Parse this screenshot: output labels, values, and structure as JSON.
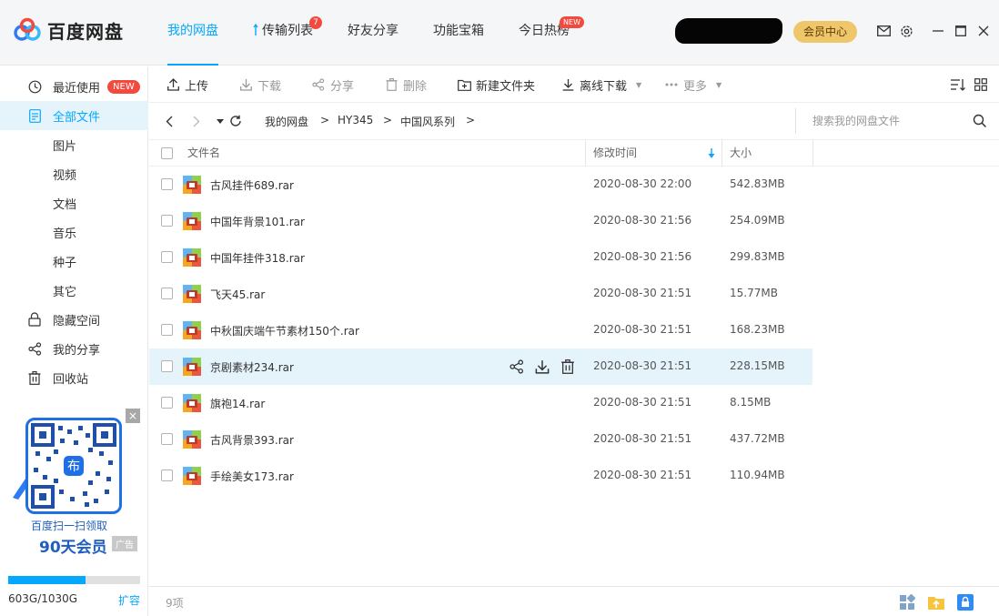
{
  "app": {
    "name": "百度网盘"
  },
  "nav": [
    {
      "label": "我的网盘",
      "active": true
    },
    {
      "label": "传输列表",
      "badge": "7"
    },
    {
      "label": "好友分享"
    },
    {
      "label": "功能宝箱"
    },
    {
      "label": "今日热榜",
      "badge": "NEW"
    }
  ],
  "header": {
    "vip_label": "会员中心"
  },
  "sidebar": {
    "items": [
      {
        "label": "最近使用",
        "badge": "NEW",
        "icon": "clock-icon"
      },
      {
        "label": "全部文件",
        "icon": "document-icon",
        "active": true
      },
      {
        "label": "图片"
      },
      {
        "label": "视频"
      },
      {
        "label": "文档"
      },
      {
        "label": "音乐"
      },
      {
        "label": "种子"
      },
      {
        "label": "其它"
      },
      {
        "label": "隐藏空间",
        "icon": "lock-icon"
      },
      {
        "label": "我的分享",
        "icon": "share-icon"
      },
      {
        "label": "回收站",
        "icon": "trash-icon"
      }
    ],
    "promo": {
      "line1": "百度扫一扫领取",
      "line2": "90天会员",
      "ad_label": "广告",
      "close": "×"
    },
    "storage": {
      "used_text": "603G/1030G",
      "fraction": 0.585,
      "expand_label": "扩容"
    }
  },
  "toolbar": {
    "upload": "上传",
    "download": "下载",
    "share": "分享",
    "delete": "删除",
    "new_folder": "新建文件夹",
    "offline_download": "离线下载",
    "more": "更多"
  },
  "path": {
    "crumbs": [
      "我的网盘",
      "HY345",
      "中国风系列"
    ],
    "separator": ">",
    "search_placeholder": "搜索我的网盘文件"
  },
  "table": {
    "headers": {
      "name": "文件名",
      "modified": "修改时间",
      "size": "大小"
    },
    "rows": [
      {
        "name": "古风挂件689.rar",
        "modified": "2020-08-30 22:00",
        "size": "542.83MB"
      },
      {
        "name": "中国年背景101.rar",
        "modified": "2020-08-30 21:56",
        "size": "254.09MB"
      },
      {
        "name": "中国年挂件318.rar",
        "modified": "2020-08-30 21:56",
        "size": "299.83MB"
      },
      {
        "name": "飞天45.rar",
        "modified": "2020-08-30 21:51",
        "size": "15.77MB"
      },
      {
        "name": "中秋国庆端午节素材150个.rar",
        "modified": "2020-08-30 21:51",
        "size": "168.23MB"
      },
      {
        "name": "京剧素材234.rar",
        "modified": "2020-08-30 21:51",
        "size": "228.15MB",
        "hovered": true
      },
      {
        "name": "旗袍14.rar",
        "modified": "2020-08-30 21:51",
        "size": "8.15MB"
      },
      {
        "name": "古风背景393.rar",
        "modified": "2020-08-30 21:51",
        "size": "437.72MB"
      },
      {
        "name": "手绘美女173.rar",
        "modified": "2020-08-30 21:51",
        "size": "110.94MB"
      }
    ]
  },
  "status": {
    "count_text": "9项"
  },
  "colors": {
    "accent": "#06a7ff",
    "badge": "#f24a3f",
    "vip": "#f0c66b",
    "hover_row": "#e5f3fb"
  }
}
